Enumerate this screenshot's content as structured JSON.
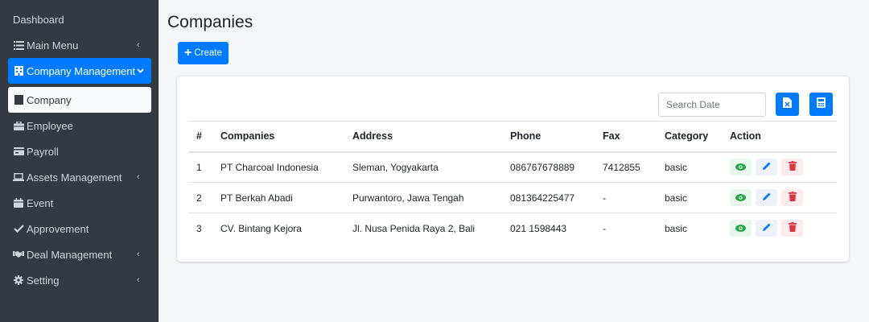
{
  "sidebar": {
    "items": [
      {
        "label": "Dashboard",
        "icon": "none",
        "chevron": ""
      },
      {
        "label": "Main Menu",
        "icon": "list-icon",
        "chevron": "‹"
      },
      {
        "label": "Company Management",
        "icon": "building-icon",
        "chevron": "⌄"
      },
      {
        "label": "Company",
        "icon": "building-icon",
        "chevron": ""
      },
      {
        "label": "Employee",
        "icon": "briefcase-icon",
        "chevron": ""
      },
      {
        "label": "Payroll",
        "icon": "money-icon",
        "chevron": ""
      },
      {
        "label": "Assets Management",
        "icon": "laptop-icon",
        "chevron": "‹"
      },
      {
        "label": "Event",
        "icon": "calendar-icon",
        "chevron": ""
      },
      {
        "label": "Approvement",
        "icon": "check-icon",
        "chevron": ""
      },
      {
        "label": "Deal Management",
        "icon": "handshake-icon",
        "chevron": "‹"
      },
      {
        "label": "Setting",
        "icon": "gear-icon",
        "chevron": "‹"
      }
    ]
  },
  "main": {
    "title": "Companies",
    "create_label": "Create",
    "search_placeholder": "Search Date",
    "table": {
      "headers": [
        "#",
        "Companies",
        "Address",
        "Phone",
        "Fax",
        "Category",
        "Action"
      ],
      "rows": [
        {
          "num": "1",
          "company": "PT Charcoal Indonesia",
          "address": "Sleman, Yogyakarta",
          "phone": "086767678889",
          "fax": "7412855",
          "category": "basic"
        },
        {
          "num": "2",
          "company": "PT Berkah Abadi",
          "address": "Purwantoro, Jawa Tengah",
          "phone": "081364225477",
          "fax": "-",
          "category": "basic"
        },
        {
          "num": "3",
          "company": "CV. Bintang Kejora",
          "address": "Jl. Nusa Penida Raya 2, Bali",
          "phone": "021 1598443",
          "fax": "-",
          "category": "basic"
        }
      ]
    }
  },
  "colors": {
    "sidebar_bg": "#343a40",
    "primary": "#007bff",
    "view_green": "#28a745",
    "edit_blue": "#007bff",
    "delete_red": "#dc3545"
  }
}
